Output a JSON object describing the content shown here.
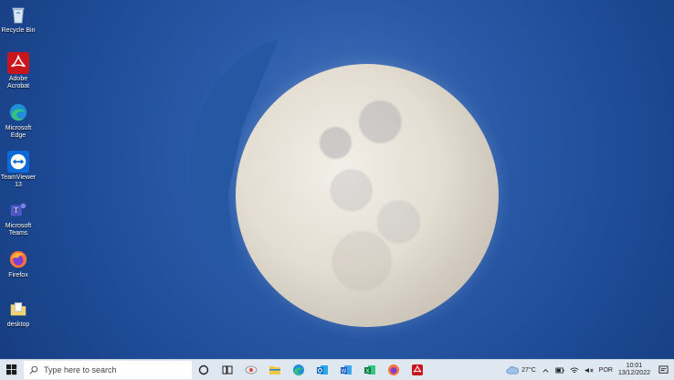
{
  "desktop": {
    "icons": [
      {
        "label": "Recycle Bin",
        "icon": "recycle-bin-icon"
      },
      {
        "label": "Adobe\nAcrobat",
        "icon": "adobe-acrobat-icon"
      },
      {
        "label": "Microsoft\nEdge",
        "icon": "edge-icon"
      },
      {
        "label": "TeamViewer\n13",
        "icon": "teamviewer-icon"
      },
      {
        "label": "Microsoft\nTeams",
        "icon": "teams-icon"
      },
      {
        "label": "Firefox",
        "icon": "firefox-icon"
      },
      {
        "label": "desktop",
        "icon": "folder-icon"
      }
    ]
  },
  "taskbar": {
    "search_placeholder": "Type here to search",
    "apps": [
      "cortana-icon",
      "task-view-icon",
      "chrome-like-icon",
      "file-explorer-icon",
      "edge-icon",
      "outlook-icon",
      "word-icon",
      "excel-icon",
      "firefox-icon",
      "acrobat-icon"
    ],
    "weather": "27°C",
    "language": "POR",
    "time": "10:01",
    "date": "13/12/2022"
  }
}
